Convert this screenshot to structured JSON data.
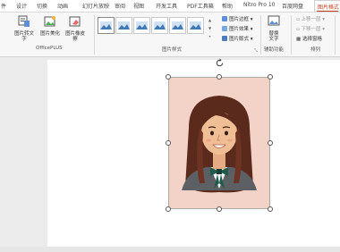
{
  "tabs": [
    {
      "label": "件"
    },
    {
      "label": "设计"
    },
    {
      "label": "切换"
    },
    {
      "label": "动画"
    },
    {
      "label": "幻灯片放映"
    },
    {
      "label": "审阅"
    },
    {
      "label": "视图"
    },
    {
      "label": "开发工具"
    },
    {
      "label": "PDF工具箱"
    },
    {
      "label": "帮助"
    },
    {
      "label": "Nitro Pro 10"
    },
    {
      "label": "百度网盘"
    },
    {
      "label": "图片格式"
    }
  ],
  "active_tab": "图片格式",
  "accent_color": "#c43e1c",
  "officeplus": {
    "buttons": [
      {
        "label": "图片转文字",
        "icon": "picture-to-text-icon"
      },
      {
        "label": "图片美化",
        "icon": "picture-beautify-icon"
      },
      {
        "label": "图片橡皮擦",
        "icon": "picture-eraser-icon"
      }
    ],
    "group_label": "OfficePLUS"
  },
  "picture_styles": {
    "group_label": "图片样式",
    "thumbnail_count": 6,
    "selected_index": 0,
    "commands": [
      {
        "label": "图片边框",
        "icon": "picture-border-icon"
      },
      {
        "label": "图片效果",
        "icon": "picture-effects-icon"
      },
      {
        "label": "图片版式",
        "icon": "picture-layout-icon"
      }
    ]
  },
  "accessibility": {
    "button_label_1": "替换",
    "button_label_2": "文字",
    "group_label": "辅助功能"
  },
  "arrange": {
    "commands": [
      {
        "label": "上移一层"
      },
      {
        "label": "下移一层"
      },
      {
        "label": "选择窗格"
      }
    ],
    "group_label": "排列"
  }
}
